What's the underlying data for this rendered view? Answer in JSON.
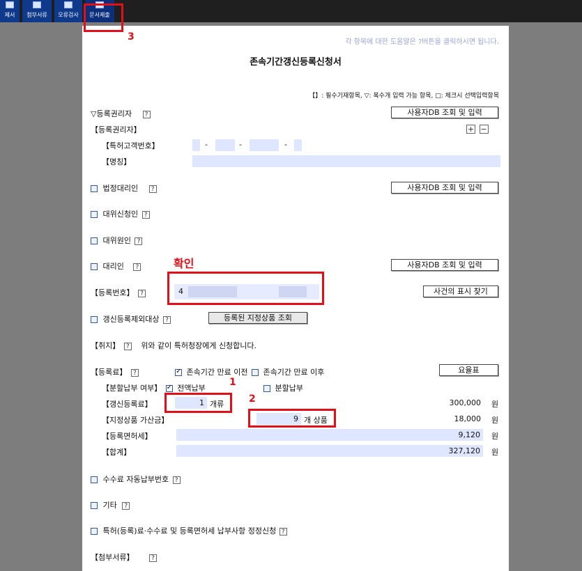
{
  "toolbar": {
    "items": [
      {
        "label": "제서",
        "active": false
      },
      {
        "label": "첨부서류",
        "active": false
      },
      {
        "label": "오류검사",
        "active": false
      },
      {
        "label": "문서제출",
        "active": true
      }
    ]
  },
  "doc": {
    "help_note": "각 항목에 대한 도움말은 ?버튼을 클릭하시면 됩니다.",
    "title": "존속기간갱신등록신청서",
    "legend": "【】: 필수기재항목, ▽: 복수개 입력 가능 항목, □: 체크시 선택입력항목",
    "help_glyph": "?",
    "reg_holder_section": "▽등록권리자",
    "user_db_button": "사용자DB 조회 및 입력",
    "reg_holder_label": "【등록권리자】",
    "plus": "+",
    "minus": "−",
    "customer_no_label": "【특허고객번호】",
    "dash": "-",
    "name_label": "【명칭】",
    "legal_rep_label": "법정대리인",
    "sub_applicant_label": "대위신청인",
    "sub_cause_label": "대위원인",
    "agent_label": "대리인",
    "reg_no_label": "【등록번호】",
    "reg_no_value": "4",
    "find_case_button": "사건의 표시 찾기",
    "exclusion_label": "갱신등록제외대상",
    "registered_goods_button": "등록된 지정상품 조회",
    "purpose_label": "【취지】",
    "purpose_text": "위와 같이 특허청장에게 신청합니다.",
    "fee_label": "【등록료】",
    "before_expiry": "존속기간 만료 이전",
    "after_expiry": "존속기간 만료 이후",
    "rate_table_button": "요율표",
    "installment_label": "【분할납부 여부】",
    "full_payment": "전액납부",
    "split_payment": "분할납부",
    "renewal_fee_label": "【갱신등록료】",
    "renewal_count": "1",
    "renewal_unit": "개류",
    "renewal_amount": "300,000",
    "goods_fee_label": "【지정상품 가산금】",
    "goods_count": "9",
    "goods_unit": "개 상품",
    "goods_amount": "18,000",
    "license_tax_label": "【등록면허세】",
    "license_tax_amount": "9,120",
    "total_label": "【합계】",
    "total_amount": "327,120",
    "won": "원",
    "auto_pay_label": "수수료 자동납부번호",
    "other_label": "기타",
    "correction_label": "특허(등록)료·수수료 및 등록면허세 납부사항 정정신청",
    "attachments_label": "【첨부서류】"
  },
  "annotations": {
    "confirm": "확인",
    "step1": "1",
    "step2": "2",
    "step3": "3"
  },
  "colors": {
    "accent": "#0f3a8c",
    "field_bg": "#dfe6ff",
    "annotation_red": "#e0101a"
  }
}
